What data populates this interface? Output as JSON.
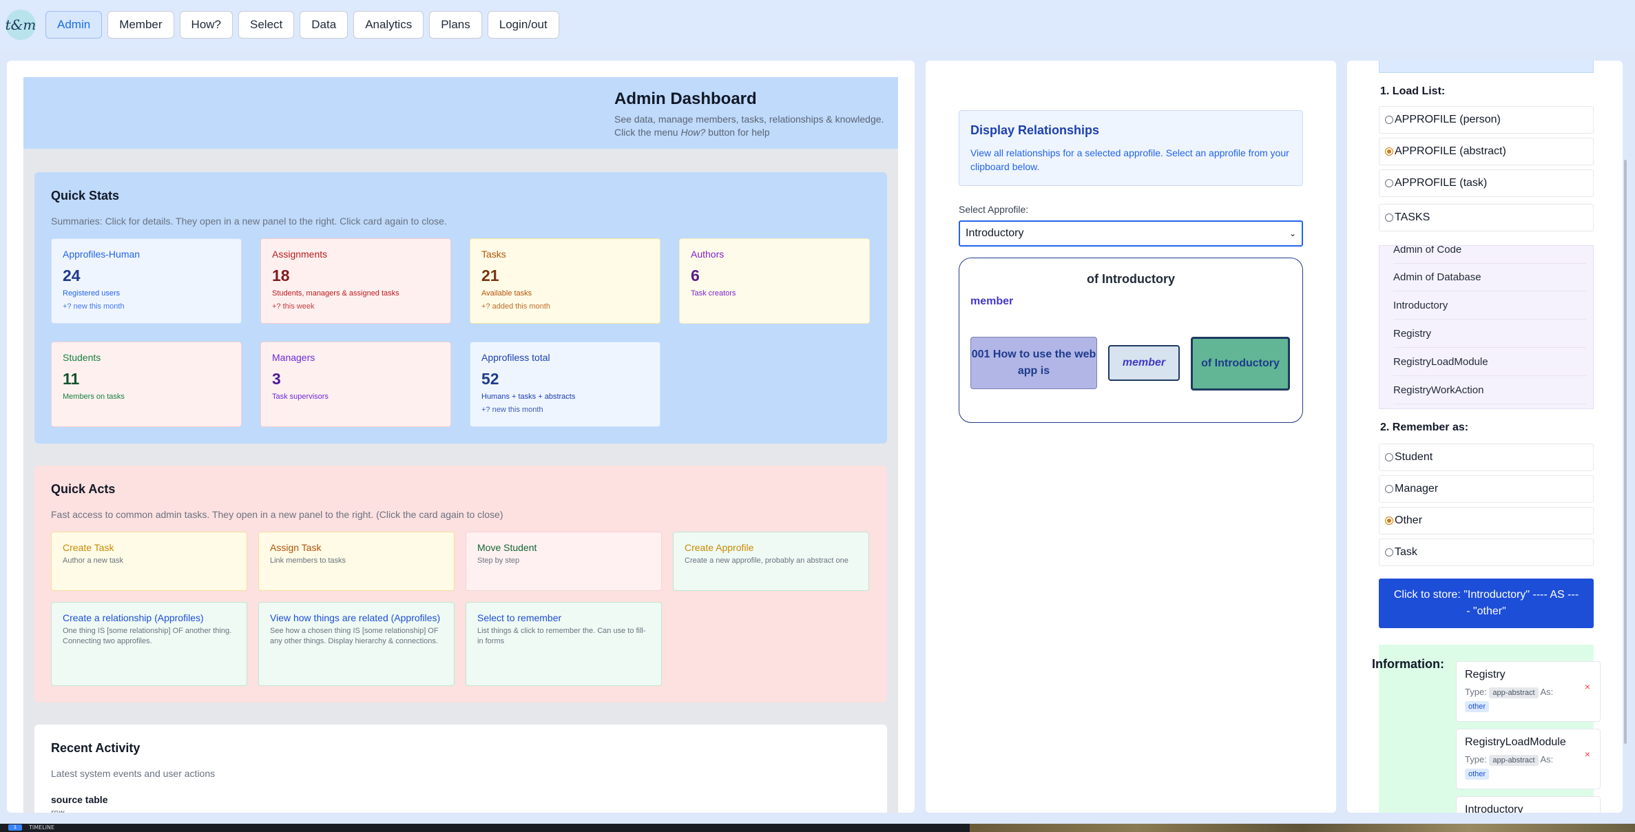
{
  "nav": {
    "logo_text": "t&m",
    "items": [
      "Admin",
      "Member",
      "How?",
      "Select",
      "Data",
      "Analytics",
      "Plans",
      "Login/out"
    ]
  },
  "header": {
    "title": "Admin Dashboard",
    "subtitle_line1": "See data, manage members, tasks, relationships & knowledge.",
    "subtitle_pre": "Click the menu ",
    "subtitle_em": "How?",
    "subtitle_post": " button for help"
  },
  "quick_stats": {
    "title": "Quick Stats",
    "desc": "Summaries: Click for details. They open in a new panel to the right. Click card again to close.",
    "cards": [
      {
        "title": "Approfiles-Human",
        "value": "24",
        "sub": "Registered users",
        "note": "+? new this month"
      },
      {
        "title": "Assignments",
        "value": "18",
        "sub": "Students, managers & assigned tasks",
        "note": "+? this week"
      },
      {
        "title": "Tasks",
        "value": "21",
        "sub": "Available tasks",
        "note": "+? added this month"
      },
      {
        "title": "Authors",
        "value": "6",
        "sub": "Task creators",
        "note": ""
      },
      {
        "title": "Students",
        "value": "11",
        "sub": "Members on tasks",
        "note": ""
      },
      {
        "title": "Managers",
        "value": "3",
        "sub": "Task supervisors",
        "note": ""
      },
      {
        "title": "Approfiless total",
        "value": "52",
        "sub": "Humans + tasks + abstracts",
        "note": "+? new this month"
      }
    ]
  },
  "quick_acts": {
    "title": "Quick Acts",
    "desc": "Fast access to common admin tasks. They open in a new panel to the right. (Click the card again to close)",
    "cards": [
      {
        "title": "Create Task",
        "sub": "Author a new task"
      },
      {
        "title": "Assign Task",
        "sub": "Link members to tasks"
      },
      {
        "title": "Move Student",
        "sub": "Step by step"
      },
      {
        "title": "Create Approfile",
        "sub": "Create a new approfile, probably an abstract one"
      },
      {
        "title": "Create a relationship (Approfiles)",
        "sub": "One thing IS [some relationship] OF another thing. Connecting two approfiles."
      },
      {
        "title": "View how things are related (Approfiles)",
        "sub": "See how a chosen thing IS [some relationship] OF any other things. Display hierarchy & connections."
      },
      {
        "title": "Select to remember",
        "sub": "List things & click to remember the. Can use to fill-in forms"
      }
    ]
  },
  "recent_activity": {
    "title": "Recent Activity",
    "desc": "Latest system events and user actions",
    "source_title": "source table",
    "source_sub": "row"
  },
  "relationships": {
    "title": "Display Relationships",
    "desc": "View all relationships for a selected approfile. Select an approfile from your clipboard below.",
    "select_label": "Select Approfile:",
    "selected": "Introductory",
    "graph_title": "of Introductory",
    "graph_member": "member",
    "node_a": "001 How to use the web app is",
    "node_b": "member",
    "node_c": "of Introductory"
  },
  "clipboard": {
    "load_label": "1. Load List:",
    "load_options": [
      {
        "label": "APPROFILE (person)",
        "checked": false
      },
      {
        "label": "APPROFILE (abstract)",
        "checked": true
      },
      {
        "label": "APPROFILE (task)",
        "checked": false
      },
      {
        "label": "TASKS",
        "checked": false
      }
    ],
    "list_items": [
      "Admin of Code",
      "Admin of Database",
      "Introductory",
      "Registry",
      "RegistryLoadModule",
      "RegistryWorkAction"
    ],
    "remember_label": "2. Remember as:",
    "remember_options": [
      {
        "label": "Student",
        "checked": false
      },
      {
        "label": "Manager",
        "checked": false
      },
      {
        "label": "Other",
        "checked": true
      },
      {
        "label": "Task",
        "checked": false
      }
    ],
    "store_button": "Click to store: \"Introductory\" ---- AS ---- \"other\"",
    "info_label": "Information:",
    "type_label": "Type:",
    "as_label": "As:",
    "close_glyph": "×",
    "stored": [
      {
        "name": "Registry",
        "type": "app-abstract",
        "as": "other"
      },
      {
        "name": "RegistryLoadModule",
        "type": "app-abstract",
        "as": "other"
      },
      {
        "name": "Introductory",
        "type": "",
        "as": ""
      }
    ]
  },
  "taskbar": {
    "badge": "1",
    "text": "TIMELINE"
  },
  "colors": {
    "accent": "#1d4ed8",
    "nav_bg": "#dde9fd",
    "stats_bg": "#bfdafb",
    "acts_bg": "#fde0e0"
  }
}
